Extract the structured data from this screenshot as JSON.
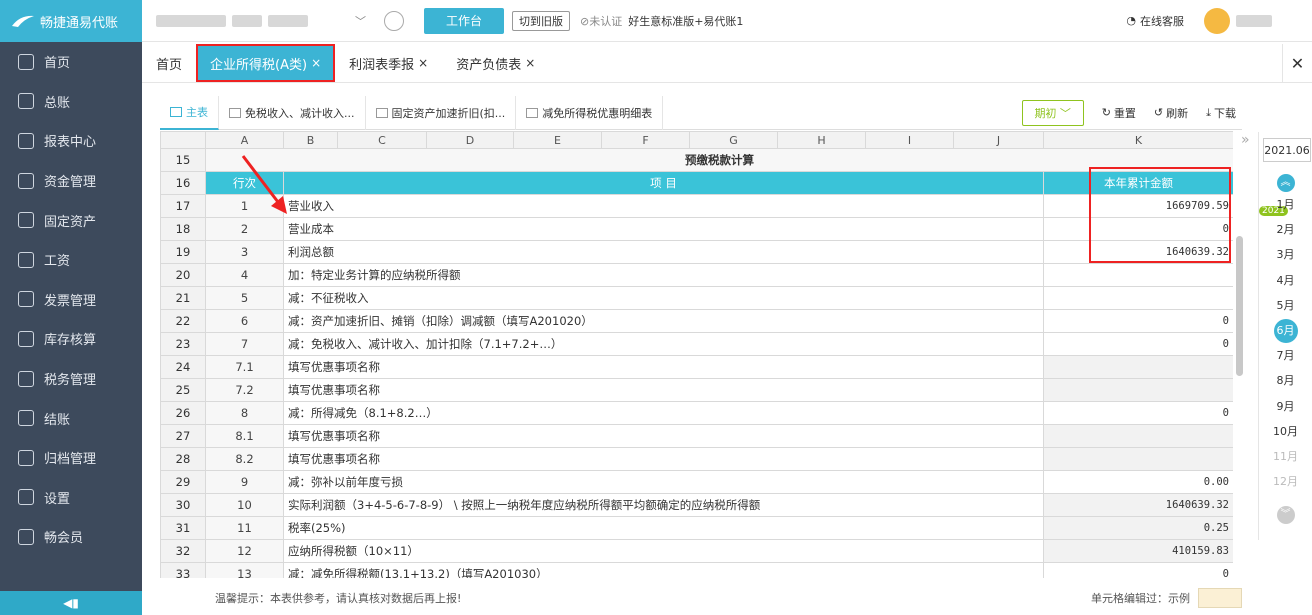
{
  "app": {
    "name": "畅捷通易代账"
  },
  "sidebar": {
    "items": [
      {
        "label": "首页",
        "icon": "home-icon"
      },
      {
        "label": "总账",
        "icon": "ledger-icon"
      },
      {
        "label": "报表中心",
        "icon": "chart-icon"
      },
      {
        "label": "资金管理",
        "icon": "money-icon"
      },
      {
        "label": "固定资产",
        "icon": "asset-icon"
      },
      {
        "label": "工资",
        "icon": "salary-icon"
      },
      {
        "label": "发票管理",
        "icon": "invoice-icon"
      },
      {
        "label": "库存核算",
        "icon": "inventory-icon"
      },
      {
        "label": "税务管理",
        "icon": "tax-icon"
      },
      {
        "label": "结账",
        "icon": "checkout-icon"
      },
      {
        "label": "归档管理",
        "icon": "archive-icon"
      },
      {
        "label": "设置",
        "icon": "gear-icon"
      },
      {
        "label": "畅会员",
        "icon": "vip-icon"
      }
    ]
  },
  "header": {
    "workbench": "工作台",
    "old_version": "切到旧版",
    "uncertified": "未认证",
    "plan": "好生意标准版+易代账1",
    "service": "在线客服"
  },
  "tabs": [
    {
      "label": "首页",
      "closable": false
    },
    {
      "label": "企业所得税(A类)",
      "closable": true,
      "active": true
    },
    {
      "label": "利润表季报",
      "closable": true
    },
    {
      "label": "资产负债表",
      "closable": true
    }
  ],
  "subtabs": [
    {
      "label": "主表",
      "active": true
    },
    {
      "label": "免税收入、减计收入..."
    },
    {
      "label": "固定资产加速折旧(扣..."
    },
    {
      "label": "减免所得税优惠明细表"
    }
  ],
  "toolbar": {
    "period": "期初",
    "reset": "重置",
    "refresh": "刷新",
    "download": "下载"
  },
  "grid": {
    "columns": [
      "A",
      "B",
      "C",
      "D",
      "E",
      "F",
      "G",
      "H",
      "I",
      "J",
      "K"
    ],
    "section_title": "预缴税款计算",
    "header_row": {
      "num": "16",
      "line": "行次",
      "item": "项 目",
      "amount": "本年累计金额"
    },
    "title_row_num": "15",
    "rows": [
      {
        "num": "17",
        "line": "1",
        "item": "营业收入",
        "value": "1669709.59"
      },
      {
        "num": "18",
        "line": "2",
        "item": "营业成本",
        "value": "0"
      },
      {
        "num": "19",
        "line": "3",
        "item": "利润总额",
        "value": "1640639.32"
      },
      {
        "num": "20",
        "line": "4",
        "item": "加：特定业务计算的应纳税所得额",
        "value": ""
      },
      {
        "num": "21",
        "line": "5",
        "item": "减：不征税收入",
        "value": ""
      },
      {
        "num": "22",
        "line": "6",
        "item": "减：资产加速折旧、摊销（扣除）调减额（填写A201020）",
        "value": "0"
      },
      {
        "num": "23",
        "line": "7",
        "item": "减：免税收入、减计收入、加计扣除（7.1+7.2+…）",
        "value": "0"
      },
      {
        "num": "24",
        "line": "7.1",
        "item": "填写优惠事项名称",
        "value": "",
        "gray": true
      },
      {
        "num": "25",
        "line": "7.2",
        "item": "填写优惠事项名称",
        "value": "",
        "gray": true
      },
      {
        "num": "26",
        "line": "8",
        "item": "减：所得减免（8.1+8.2…）",
        "value": "0"
      },
      {
        "num": "27",
        "line": "8.1",
        "item": "填写优惠事项名称",
        "value": "",
        "gray": true
      },
      {
        "num": "28",
        "line": "8.2",
        "item": "填写优惠事项名称",
        "value": "",
        "gray": true
      },
      {
        "num": "29",
        "line": "9",
        "item": "减：弥补以前年度亏损",
        "value": "0.00"
      },
      {
        "num": "30",
        "line": "10",
        "item": "实际利润额（3+4-5-6-7-8-9） \\ 按照上一纳税年度应纳税所得额平均额确定的应纳税所得额",
        "value": "1640639.32",
        "gray": true
      },
      {
        "num": "31",
        "line": "11",
        "item": "税率(25%)",
        "value": "0.25",
        "gray": true
      },
      {
        "num": "32",
        "line": "12",
        "item": "应纳所得税额（10×11）",
        "value": "410159.83",
        "gray": true
      },
      {
        "num": "33",
        "line": "13",
        "item": "减：减免所得税额(13.1+13.2)（填写A201030）",
        "value": "0"
      }
    ]
  },
  "months": {
    "current": "2021.06",
    "year_badge": "2021",
    "list": [
      {
        "label": "1月"
      },
      {
        "label": "2月"
      },
      {
        "label": "3月"
      },
      {
        "label": "4月"
      },
      {
        "label": "5月"
      },
      {
        "label": "6月",
        "selected": true
      },
      {
        "label": "7月"
      },
      {
        "label": "8月"
      },
      {
        "label": "9月"
      },
      {
        "label": "10月"
      },
      {
        "label": "11月",
        "disabled": true
      },
      {
        "label": "12月",
        "disabled": true
      }
    ]
  },
  "footer": {
    "tip": "温馨提示：本表供参考，请认真核对数据后再上报!",
    "legend": "单元格编辑过：示例"
  }
}
